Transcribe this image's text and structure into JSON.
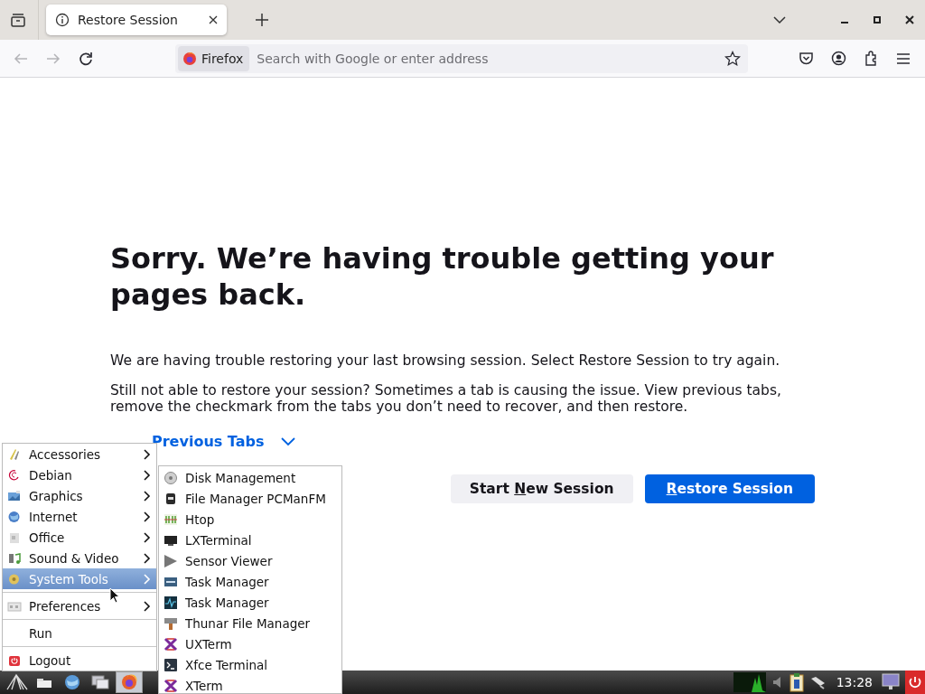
{
  "browser": {
    "tabs": [
      {
        "title": "Restore Session",
        "selected": true
      }
    ],
    "nav_buttons": [
      {
        "kind": "back",
        "disabled": true
      },
      {
        "kind": "forward",
        "disabled": true
      },
      {
        "kind": "reload",
        "disabled": false
      }
    ],
    "identity": "Firefox",
    "address_placeholder": "Search with Google or enter address"
  },
  "page": {
    "heading": "Sorry. We’re having trouble getting your pages back.",
    "paragraphs": [
      "We are having trouble restoring your last browsing session. Select Restore Session to try again.",
      "Still not able to restore your session? Sometimes a tab is causing the issue. View previous tabs, remove the checkmark from the tabs you don’t need to recover, and then restore."
    ],
    "previous_tabs_link": "Previous Tabs",
    "buttons": [
      {
        "kind": "secondary",
        "before": "Start ",
        "key": "N",
        "after": "ew Session"
      },
      {
        "kind": "primary",
        "key": "R",
        "after": "estore Session"
      }
    ]
  },
  "menu": {
    "items": [
      {
        "kind": "item",
        "label": "Accessories",
        "submenu": true,
        "selected": false
      },
      {
        "kind": "item",
        "label": "Debian",
        "submenu": true,
        "selected": false
      },
      {
        "kind": "item",
        "label": "Graphics",
        "submenu": true,
        "selected": false
      },
      {
        "kind": "item",
        "label": "Internet",
        "submenu": true,
        "selected": false
      },
      {
        "kind": "item",
        "label": "Office",
        "submenu": true,
        "selected": false
      },
      {
        "kind": "item",
        "label": "Sound & Video",
        "submenu": true,
        "selected": false
      },
      {
        "kind": "item",
        "label": "System Tools",
        "submenu": true,
        "selected": true
      },
      {
        "kind": "separator"
      },
      {
        "kind": "item",
        "label": "Preferences",
        "submenu": true,
        "selected": false
      },
      {
        "kind": "separator"
      },
      {
        "kind": "item",
        "label": "Run",
        "submenu": false,
        "selected": false
      },
      {
        "kind": "separator"
      },
      {
        "kind": "item",
        "label": "Logout",
        "submenu": false,
        "selected": false
      }
    ],
    "submenu": [
      {
        "label": "Disk Management"
      },
      {
        "label": "File Manager PCManFM"
      },
      {
        "label": "Htop"
      },
      {
        "label": "LXTerminal"
      },
      {
        "label": "Sensor Viewer"
      },
      {
        "label": "Task Manager"
      },
      {
        "label": "Task Manager"
      },
      {
        "label": "Thunar File Manager"
      },
      {
        "label": "UXTerm"
      },
      {
        "label": "Xfce Terminal"
      },
      {
        "label": "XTerm"
      }
    ]
  },
  "taskbar": {
    "launchers": [
      {
        "kind": "start",
        "selected": false
      },
      {
        "kind": "files",
        "selected": false
      },
      {
        "kind": "globe",
        "selected": false
      },
      {
        "kind": "windows",
        "selected": false
      },
      {
        "kind": "firefox",
        "selected": true
      }
    ],
    "clock": "13:28"
  }
}
